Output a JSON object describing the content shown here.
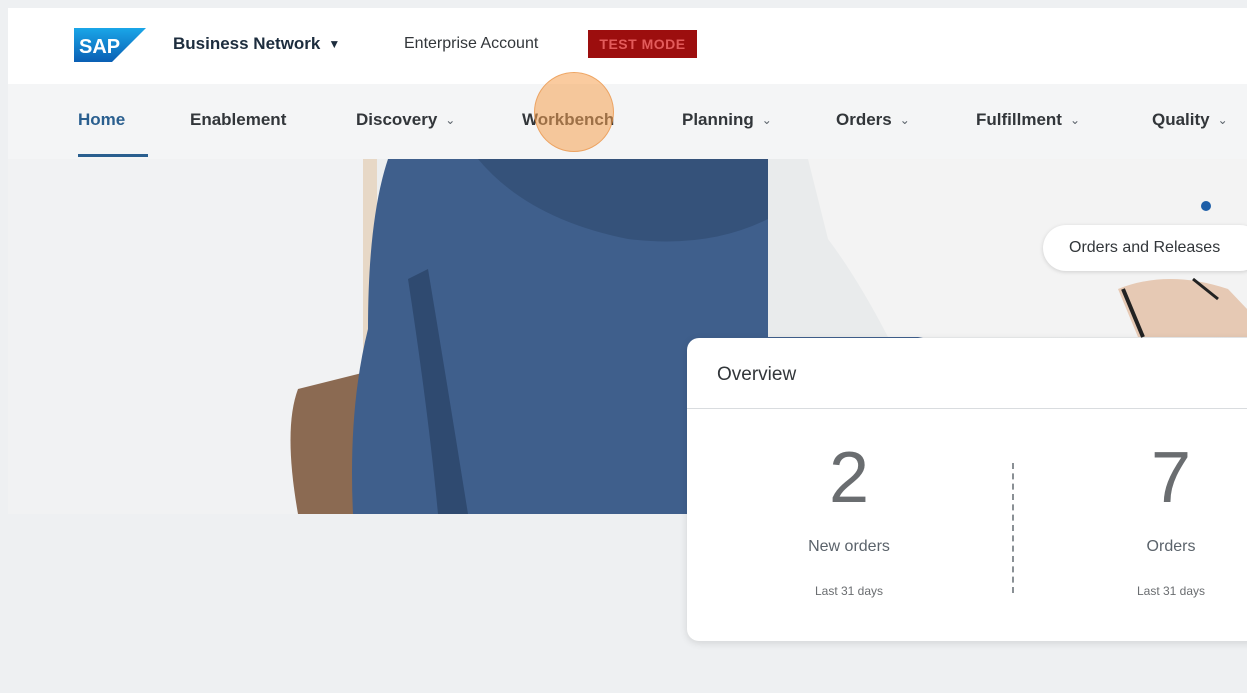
{
  "header": {
    "logo_text": "SAP",
    "brand": "Business Network",
    "brand_caret": "▼",
    "account": "Enterprise Account",
    "badge": "TEST MODE"
  },
  "nav": {
    "items": [
      {
        "label": "Home",
        "active": true,
        "chevron": ""
      },
      {
        "label": "Enablement",
        "chevron": ""
      },
      {
        "label": "Discovery",
        "chevron": "⌄"
      },
      {
        "label": "Workbench",
        "chevron": ""
      },
      {
        "label": "Planning",
        "chevron": "⌄"
      },
      {
        "label": "Orders",
        "chevron": "⌄"
      },
      {
        "label": "Fulfillment",
        "chevron": "⌄"
      },
      {
        "label": "Quality",
        "chevron": "⌄"
      }
    ]
  },
  "hero": {
    "pill": "Orders and Releases"
  },
  "overview": {
    "title": "Overview",
    "kpis": [
      {
        "value": "2",
        "label": "New orders",
        "period": "Last 31 days"
      },
      {
        "value": "7",
        "label": "Orders",
        "period": "Last 31 days"
      }
    ]
  },
  "colors": {
    "accent": "#2a5f8f",
    "badge_bg": "#9c0e0e",
    "logo_blue": "#0a6ed1"
  }
}
